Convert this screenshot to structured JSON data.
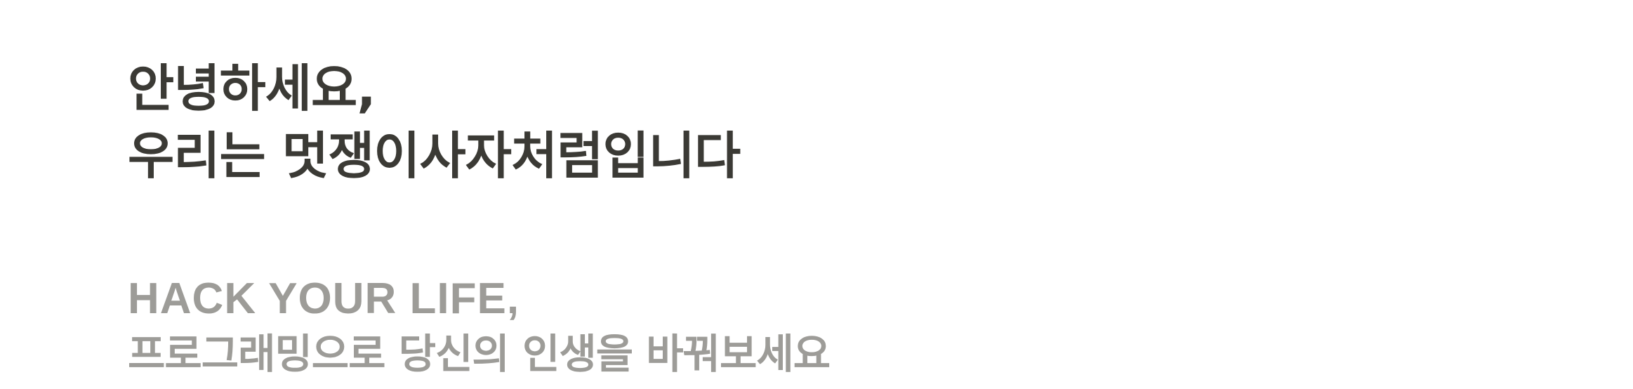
{
  "hero": {
    "line1": "안녕하세요,",
    "line2": "우리는 멋쟁이사자처럼입니다"
  },
  "sub": {
    "tagline": "HACK YOUR LIFE,",
    "description": "프로그래밍으로 당신의 인생을 바꿔보세요"
  },
  "colors": {
    "headline": "#3b3a35",
    "subtext": "#9d9c98",
    "background": "#ffffff"
  }
}
